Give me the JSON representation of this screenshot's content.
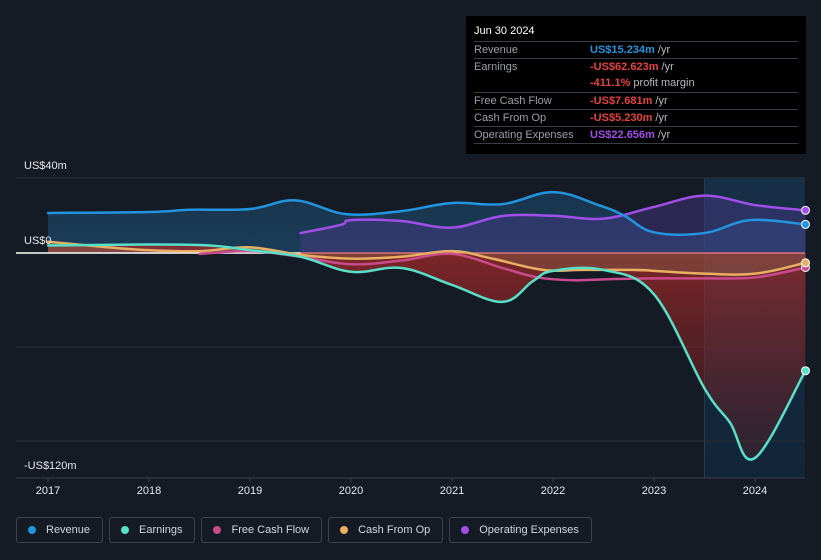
{
  "tooltip": {
    "date": "Jun 30 2024",
    "rows": [
      {
        "label": "Revenue",
        "value": "US$15.234m",
        "unit": " /yr",
        "color": "#2394df"
      },
      {
        "label": "Earnings",
        "value": "-US$62.623m",
        "unit": " /yr",
        "color": "#e64141"
      },
      {
        "label": "",
        "value": "-411.1%",
        "unit": " profit margin",
        "color": "#e64141"
      },
      {
        "label": "Free Cash Flow",
        "value": "-US$7.681m",
        "unit": " /yr",
        "color": "#e64141"
      },
      {
        "label": "Cash From Op",
        "value": "-US$5.230m",
        "unit": " /yr",
        "color": "#e64141"
      },
      {
        "label": "Operating Expenses",
        "value": "US$22.656m",
        "unit": " /yr",
        "color": "#a04fe8"
      }
    ]
  },
  "legend": [
    {
      "label": "Revenue",
      "color": "#2394df"
    },
    {
      "label": "Earnings",
      "color": "#58e0c9"
    },
    {
      "label": "Free Cash Flow",
      "color": "#c84b8c"
    },
    {
      "label": "Cash From Op",
      "color": "#e9b063"
    },
    {
      "label": "Operating Expenses",
      "color": "#a04fe8"
    }
  ],
  "chart_data": {
    "type": "line",
    "title": "",
    "xlabel": "",
    "ylabel": "",
    "y_tick_labels": [
      "US$40m",
      "US$0",
      "-US$120m"
    ],
    "x_tick_labels": [
      "2017",
      "2018",
      "2019",
      "2020",
      "2021",
      "2022",
      "2023",
      "2024"
    ],
    "xlim": [
      2016.7,
      2024.5
    ],
    "ylim": [
      -120,
      40
    ],
    "gridlines": [
      40,
      0,
      -50,
      -100
    ],
    "highlight_from": 2023.5,
    "series": [
      {
        "name": "Revenue",
        "color": "#2394df",
        "x": [
          2017.0,
          2018.0,
          2018.4,
          2019.0,
          2019.45,
          2019.95,
          2020.5,
          2021.0,
          2021.5,
          2022.0,
          2022.45,
          2022.7,
          2023.0,
          2023.5,
          2023.95,
          2024.5
        ],
        "y": [
          21.3,
          21.8,
          23.0,
          23.4,
          28.0,
          20.7,
          22.3,
          26.6,
          26.0,
          32.4,
          25.5,
          20.0,
          11.0,
          10.6,
          17.5,
          15.2
        ]
      },
      {
        "name": "Earnings",
        "color": "#58e0c9",
        "x": [
          2017.0,
          2018.0,
          2018.6,
          2019.0,
          2019.5,
          2020.0,
          2020.5,
          2021.0,
          2021.5,
          2021.8,
          2022.0,
          2022.5,
          2023.0,
          2023.5,
          2023.75,
          2024.0,
          2024.5
        ],
        "y": [
          4.0,
          4.5,
          4.0,
          1.5,
          -2.0,
          -10.0,
          -8.0,
          -17.0,
          -26.0,
          -15.0,
          -9.5,
          -9.0,
          -22.0,
          -72.0,
          -90.0,
          -109.0,
          -62.6
        ]
      },
      {
        "name": "Free Cash Flow",
        "color": "#c84b8c",
        "x": [
          2018.5,
          2019.0,
          2019.5,
          2020.0,
          2020.5,
          2021.0,
          2021.5,
          2021.85,
          2022.2,
          2022.5,
          2023.0,
          2023.5,
          2024.0,
          2024.5
        ],
        "y": [
          -0.5,
          1.0,
          -2.0,
          -6.0,
          -4.0,
          -0.5,
          -8.0,
          -13.0,
          -14.5,
          -14.0,
          -13.5,
          -13.5,
          -13.0,
          -7.7
        ]
      },
      {
        "name": "Cash From Op",
        "color": "#e9b063",
        "x": [
          2017.0,
          2017.6,
          2018.0,
          2018.5,
          2019.0,
          2019.5,
          2020.0,
          2020.5,
          2021.0,
          2021.4,
          2021.9,
          2022.3,
          2022.8,
          2023.0,
          2023.5,
          2024.0,
          2024.5
        ],
        "y": [
          6.0,
          3.0,
          1.5,
          1.0,
          3.0,
          -1.0,
          -3.0,
          -2.0,
          1.0,
          -3.0,
          -9.0,
          -9.0,
          -9.0,
          -9.5,
          -11.0,
          -11.0,
          -5.2
        ]
      },
      {
        "name": "Operating Expenses",
        "color": "#a04fe8",
        "x": [
          2019.5,
          2019.9,
          2020.0,
          2020.5,
          2021.0,
          2021.5,
          2022.0,
          2022.5,
          2023.0,
          2023.5,
          2024.0,
          2024.5
        ],
        "y": [
          10.6,
          15.0,
          17.5,
          17.0,
          13.5,
          19.7,
          19.8,
          18.3,
          24.5,
          30.5,
          25.5,
          22.7
        ]
      }
    ]
  }
}
